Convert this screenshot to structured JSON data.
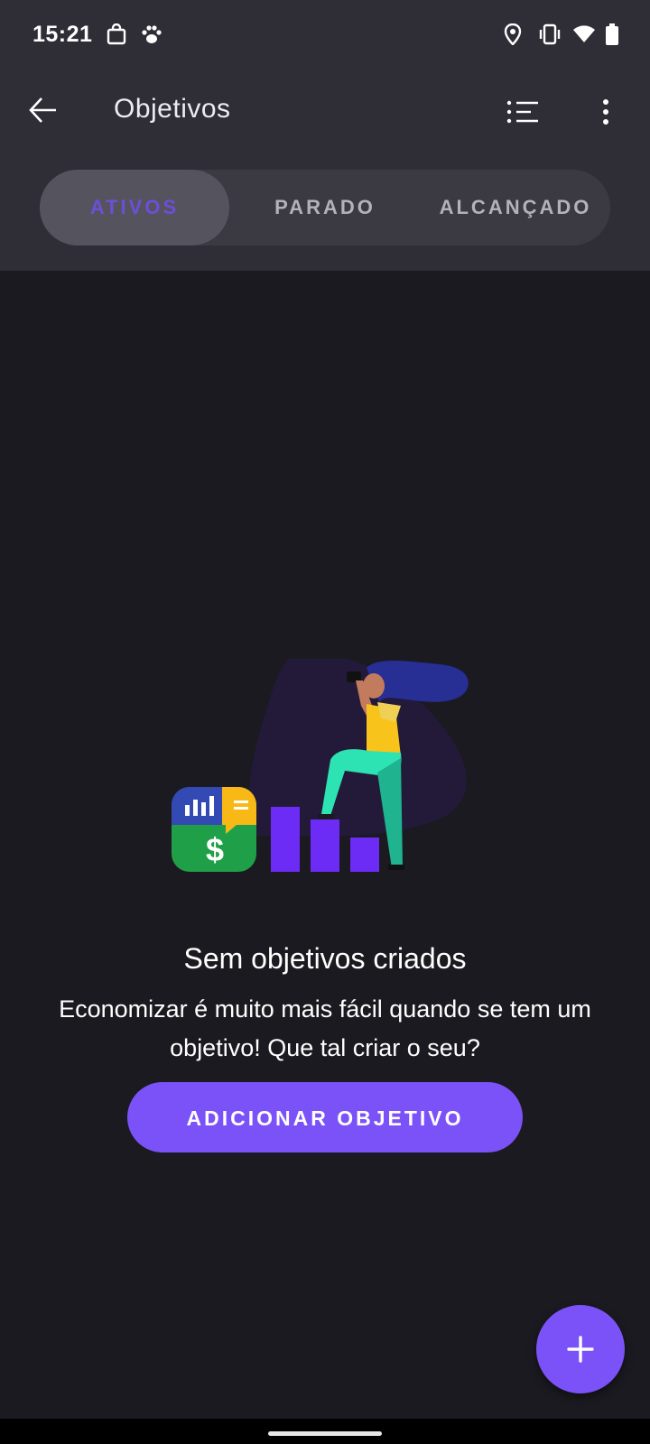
{
  "status_bar": {
    "time": "15:21",
    "left_icons": [
      "shopping-bag-icon",
      "paw-icon"
    ],
    "right_icons": [
      "location-icon",
      "vibrate-icon",
      "wifi-icon",
      "battery-icon"
    ]
  },
  "app_bar": {
    "title": "Objetivos",
    "back_icon": "arrow-left-icon",
    "actions": [
      "list-icon",
      "more-vert-icon"
    ]
  },
  "tabs": [
    {
      "label": "ATIVOS",
      "active": true
    },
    {
      "label": "PARADO",
      "active": false
    },
    {
      "label": "ALCANÇADO",
      "active": false
    }
  ],
  "empty_state": {
    "title": "Sem objetivos criados",
    "description": "Economizar é muito mais fácil quando se tem um objetivo! Que tal criar o seu?",
    "button_label": "ADICIONAR OBJETIVO"
  },
  "fab": {
    "icon": "plus-icon"
  },
  "colors": {
    "accent": "#7b52f8",
    "active_tab_text": "#6c4fd8",
    "header_bg": "#2f2e37",
    "body_bg": "#1b1a20"
  }
}
